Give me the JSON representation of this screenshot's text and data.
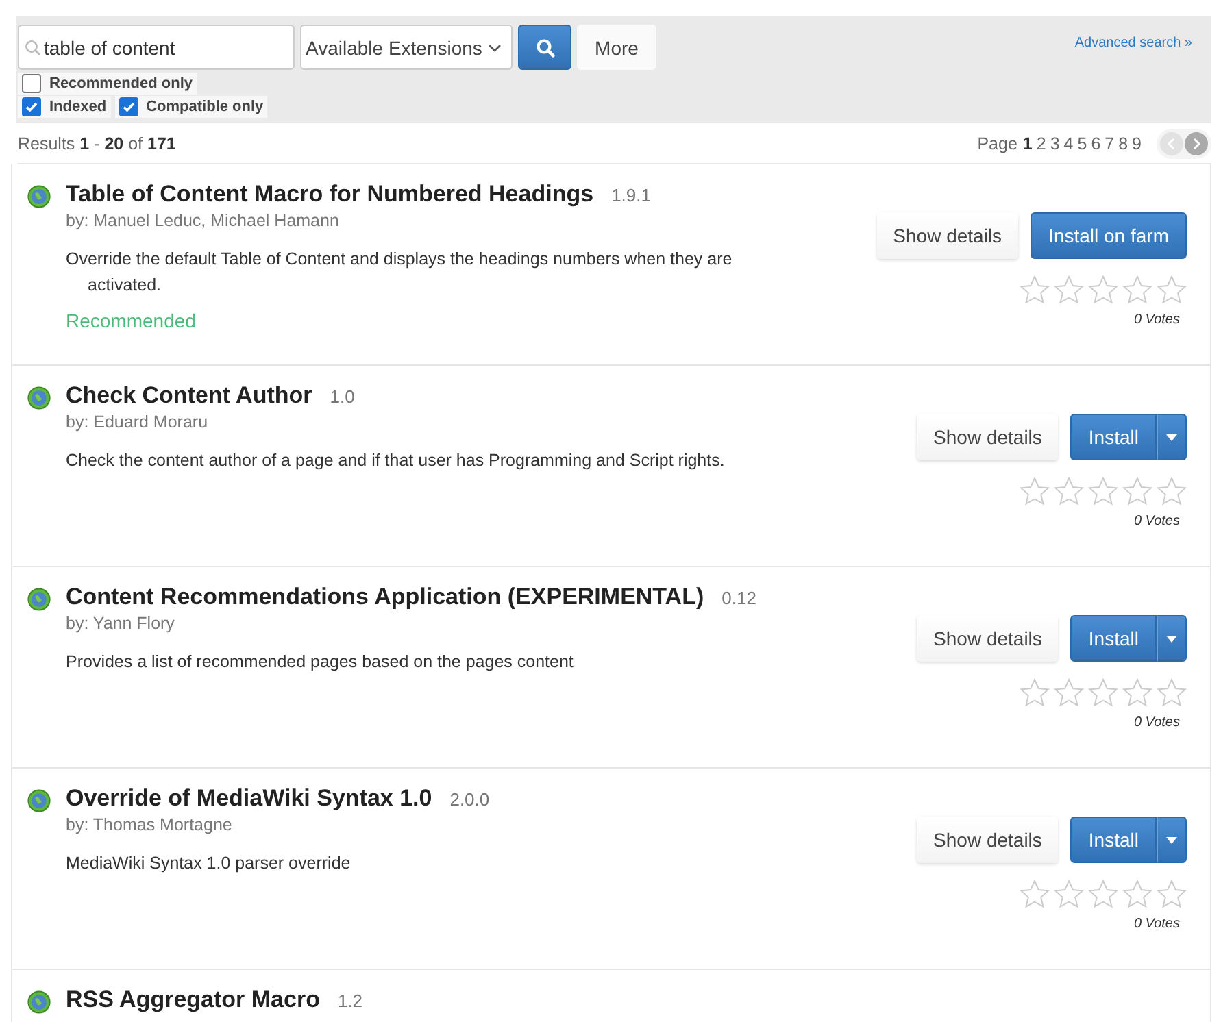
{
  "search": {
    "query": "table of content",
    "scope": "Available Extensions",
    "more_label": "More",
    "advanced_link": "Advanced search »"
  },
  "filters": [
    {
      "label": "Recommended only",
      "checked": false
    },
    {
      "label": "Indexed",
      "checked": true
    },
    {
      "label": "Compatible only",
      "checked": true
    }
  ],
  "results_summary": "Results **1** - **20** of **171**",
  "pager": {
    "label": "Page",
    "pages": [
      {
        "label": "1",
        "selected": true
      },
      {
        "label": "2",
        "selected": false
      },
      {
        "label": "3",
        "selected": false
      },
      {
        "label": "4",
        "selected": false
      },
      {
        "label": "5",
        "selected": false
      },
      {
        "label": "6",
        "selected": false
      },
      {
        "label": "7",
        "selected": false
      },
      {
        "label": "8",
        "selected": false
      },
      {
        "label": "9",
        "selected": false
      }
    ],
    "prev_disabled": true,
    "next_disabled": false
  },
  "extensions": [
    {
      "name": "Table of Content Macro for Numbered Headings",
      "version": "1.9.1",
      "authors": "by: Manuel Leduc, Michael Hamann",
      "description": "Override the default Table of Content and displays the headings numbers when they are activated.",
      "recommended_label": "Recommended",
      "details_label": "Show details",
      "install": {
        "kind": "plain",
        "label": "Install on farm"
      },
      "stars": 0,
      "votes": "0 Votes"
    },
    {
      "name": "Check Content Author",
      "version": "1.0",
      "authors": "by: Eduard Moraru",
      "description": "Check the content author of a page and if that user has Programming and Script rights.",
      "details_label": "Show details",
      "install": {
        "kind": "split",
        "label": "Install"
      },
      "stars": 0,
      "votes": "0 Votes"
    },
    {
      "name": "Content Recommendations Application (EXPERIMENTAL)",
      "version": "0.12",
      "authors": "by: Yann Flory",
      "description": "Provides a list of recommended pages based on the pages content",
      "details_label": "Show details",
      "install": {
        "kind": "split",
        "label": "Install"
      },
      "stars": 0,
      "votes": "0 Votes"
    },
    {
      "name": "Override of MediaWiki Syntax 1.0",
      "version": "2.0.0",
      "authors": "by: Thomas Mortagne",
      "description": "MediaWiki Syntax 1.0 parser override",
      "details_label": "Show details",
      "install": {
        "kind": "split",
        "label": "Install"
      },
      "stars": 0,
      "votes": "0 Votes"
    },
    {
      "name": "RSS Aggregator Macro",
      "version": "1.2"
    }
  ]
}
